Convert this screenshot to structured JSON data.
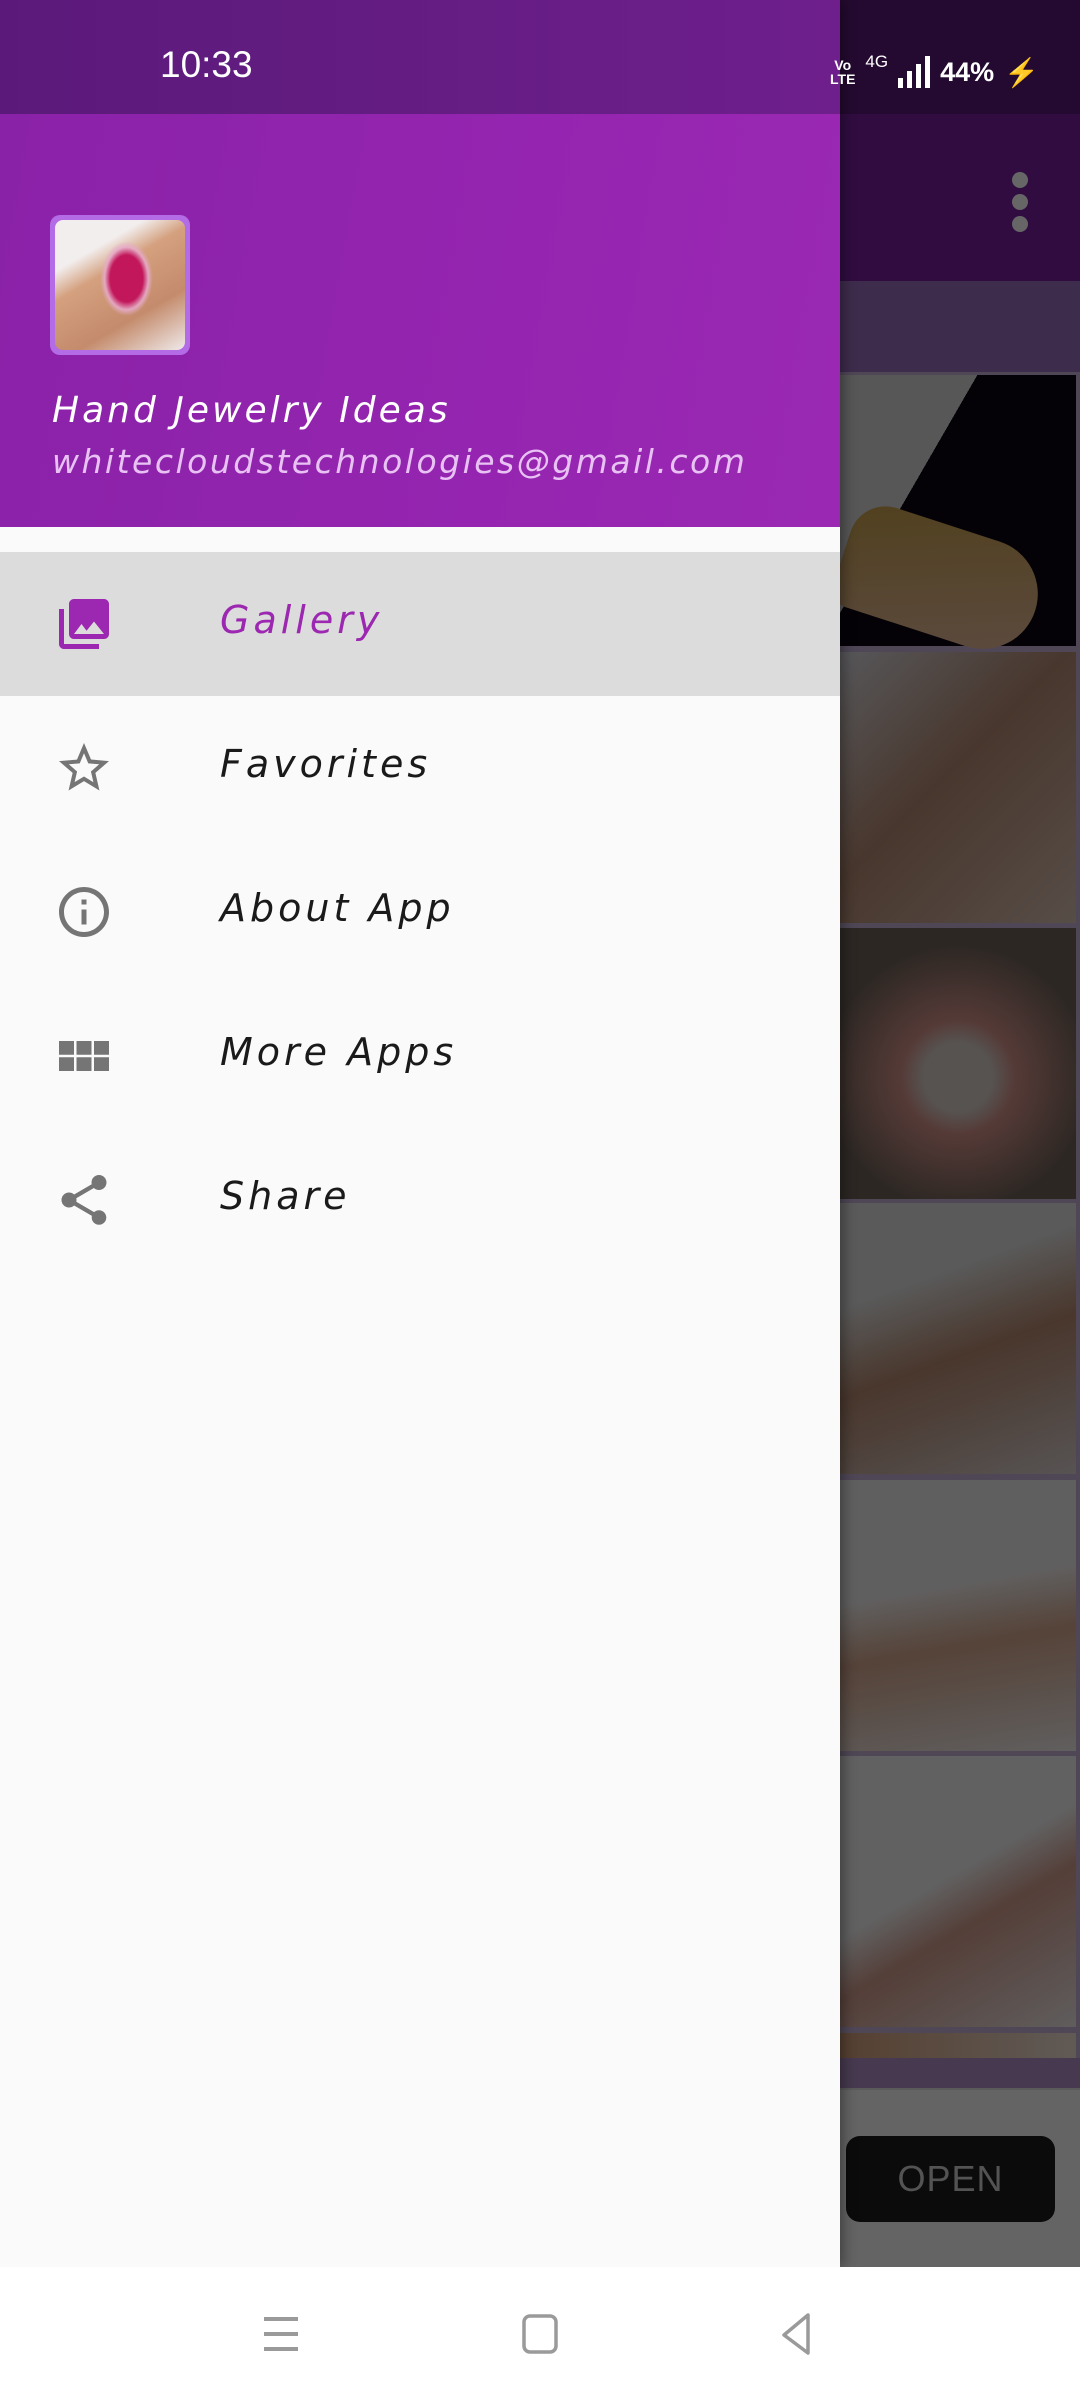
{
  "status_bar": {
    "time": "10:33",
    "volte_top": "Vo",
    "volte_bottom": "LTE",
    "network": "4G",
    "battery": "44%",
    "signal_icon": "signal-bars-icon",
    "charging_icon": "charging-bolt-icon"
  },
  "drawer": {
    "header": {
      "app_name": "Hand Jewelry Ideas",
      "email": "whitecloudstechnologies@gmail.com",
      "avatar": "app-logo-hand-jewelry"
    },
    "items": [
      {
        "label": "Gallery",
        "icon": "gallery-icon",
        "active": true
      },
      {
        "label": "Favorites",
        "icon": "star-icon",
        "active": false
      },
      {
        "label": "About App",
        "icon": "info-icon",
        "active": false
      },
      {
        "label": "More Apps",
        "icon": "apps-grid-icon",
        "active": false
      },
      {
        "label": "Share",
        "icon": "share-icon",
        "active": false
      }
    ],
    "active_color": "#9c27b0",
    "icon_color": "#757575"
  },
  "background_app": {
    "toolbar_menu_icon": "more-vert-icon",
    "gallery_images": [
      "hand-jewelry-1",
      "hand-jewelry-2",
      "hand-jewelry-3",
      "hand-jewelry-4",
      "hand-jewelry-5",
      "hand-jewelry-6",
      "hand-jewelry-7"
    ],
    "ad_button_label": "OPEN",
    "primary_color": "#7b1fa2"
  },
  "nav_bar": {
    "recents_icon": "recents-icon",
    "home_icon": "home-icon",
    "back_icon": "back-icon"
  }
}
